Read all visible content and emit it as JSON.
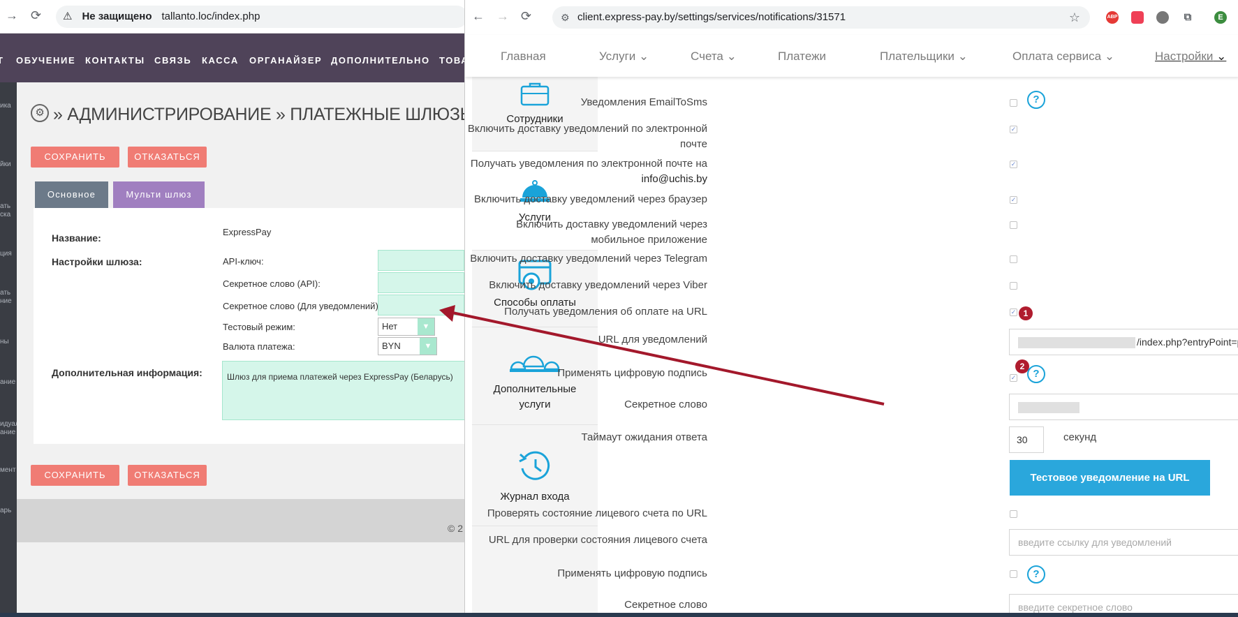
{
  "left_window": {
    "omnibox": {
      "security_warning": "Не защищено",
      "url": "tallanto.loc/index.php"
    },
    "menu": [
      "ОБУЧЕНИЕ",
      "КОНТАКТЫ",
      "СВЯЗЬ",
      "КАССА",
      "ОРГАНАЙЗЕР",
      "ДОПОЛНИТЕЛЬНО",
      "ТОВА"
    ],
    "sidebar_fragments": [
      "ика",
      "йки",
      "ать",
      "ска",
      "ция",
      "ать",
      "ние",
      "ны",
      "ание",
      "идуал",
      "ание",
      "мент",
      "арь"
    ],
    "page_heading": "» АДМИНИСТРИРОВАНИЕ » ПЛАТЕЖНЫЕ ШЛЮЗЫ",
    "buttons": {
      "save": "СОХРАНИТЬ",
      "cancel": "ОТКАЗАТЬСЯ"
    },
    "tabs": {
      "main": "Основное",
      "multi": "Мульти шлюз"
    },
    "form": {
      "name_label": "Название:",
      "name_value": "ExpressPay",
      "gateway_settings_label": "Настройки шлюза:",
      "api_key_label": "API-ключ:",
      "secret_api_label": "Секретное слово (API):",
      "secret_notify_label": "Секретное слово (Для уведомлений):",
      "test_mode_label": "Тестовый режим:",
      "test_mode_value": "Нет",
      "currency_label": "Валюта платежа:",
      "currency_value": "BYN",
      "extra_info_label": "Дополнительная информация:",
      "extra_info_value": "Шлюз для приема платежей через ExpressPay (Беларусь)"
    },
    "footer_text": "© 2"
  },
  "right_window": {
    "omnibox": {
      "url": "client.express-pay.by/settings/services/notifications/31571"
    },
    "extensions": [
      "ABP",
      "pocket",
      "ext",
      "puzzle"
    ],
    "profile_initial": "E",
    "nav": {
      "home": "Главная",
      "services": "Услуги",
      "invoices": "Счета",
      "payments": "Платежи",
      "payers": "Плательщики",
      "service_payment": "Оплата сервиса",
      "settings": "Настройки"
    },
    "sidebar": {
      "employees": "Сотрудники",
      "services": "Услуги",
      "payment_methods": "Способы оплаты",
      "additional_services_1": "Дополнительные",
      "additional_services_2": "услуги",
      "login_log": "Журнал входа"
    },
    "settings": {
      "email_to_sms": "Уведомления EmailToSms",
      "email_delivery_1": "Включить доставку уведомлений по электронной",
      "email_delivery_2": "почте",
      "email_receive_1": "Получать уведомления по электронной почте на",
      "email_receive_2": "info@uchis.by",
      "browser_delivery": "Включить доставку уведомлений через браузер",
      "mobile_delivery_1": "Включить доставку уведомлений через",
      "mobile_delivery_2": "мобильное приложение",
      "telegram_delivery": "Включить доставку уведомлений через Telegram",
      "viber_delivery": "Включить доставку уведомлений через Viber",
      "url_payment_notify": "Получать уведомления об оплате на URL",
      "notify_url_label": "URL для уведомлений",
      "notify_url_value": "/index.php?entryPoint=pg&pg=ex...",
      "digital_signature": "Применять цифровую подпись",
      "secret_word": "Секретное слово",
      "timeout_label": "Таймаут ожидания ответа",
      "timeout_value": "30",
      "timeout_unit": "секунд",
      "test_notify_button": "Тестовое уведомление на URL",
      "check_account": "Проверять состояние лицевого счета по URL",
      "check_account_url_label": "URL для проверки состояния лицевого счета",
      "check_account_url_placeholder": "введите ссылку для уведомлений",
      "digital_signature_2": "Применять цифровую подпись",
      "secret_word_2": "Секретное слово",
      "secret_word_placeholder": "введите секретное слово"
    },
    "badges": {
      "one": "1",
      "two": "2"
    }
  },
  "colors": {
    "left_menu_bg": "#4f4359",
    "left_button_red": "#f07c74",
    "left_tab_gray": "#6c7a89",
    "left_tab_purple": "#a07fc0",
    "left_field_green": "#d5f6ea",
    "right_accent_blue": "#2aa7dc",
    "badge_red": "#b01c2e",
    "arrow_red": "#a3182b"
  }
}
